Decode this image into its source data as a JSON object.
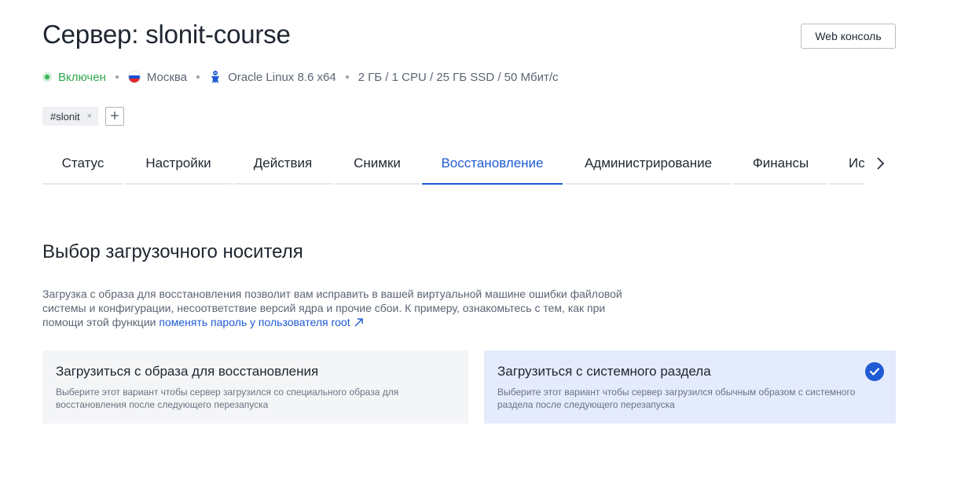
{
  "header": {
    "title": "Сервер: slonit-course",
    "web_console_label": "Web консоль"
  },
  "meta": {
    "status": "Включен",
    "location": "Москва",
    "os": "Oracle Linux 8.6 x64",
    "specs": "2 ГБ / 1 CPU / 25 ГБ SSD / 50 Мбит/с",
    "status_color": "#2fa84f"
  },
  "tags": [
    {
      "label": "#slonit",
      "remove_symbol": "×"
    }
  ],
  "tag_add_symbol": "+",
  "tabs": [
    {
      "label": "Статус",
      "active": false
    },
    {
      "label": "Настройки",
      "active": false
    },
    {
      "label": "Действия",
      "active": false
    },
    {
      "label": "Снимки",
      "active": false
    },
    {
      "label": "Восстановление",
      "active": true
    },
    {
      "label": "Администрирование",
      "active": false
    },
    {
      "label": "Финансы",
      "active": false
    },
    {
      "label": "История",
      "active": false
    }
  ],
  "section": {
    "title": "Выбор загрузочного носителя",
    "description": "Загрузка с образа для восстановления позволит вам исправить в вашей виртуальной машине ошибки файловой системы и конфигурации, несоответствие версий ядра и прочие сбои. К примеру, ознакомьтесь с тем, как при помощи этой функции",
    "link_text": "поменять пароль у пользователя root"
  },
  "options": [
    {
      "title": "Загрузиться с образа для восстановления",
      "text": "Выберите этот вариант чтобы сервер загрузился со специального образа для восстановления после следующего перезапуска",
      "selected": false
    },
    {
      "title": "Загрузиться с системного раздела",
      "text": "Выберите этот вариант чтобы сервер загрузился обычным образом с системного раздела после следующего перезапуска",
      "selected": true
    }
  ],
  "colors": {
    "accent": "#1f5bd4",
    "selected_card_bg": "#e4ebfc",
    "card_bg": "#f4f5f7"
  },
  "icons": {
    "status": "status-dot-icon",
    "location": "russia-flag-icon",
    "os": "oracle-linux-icon",
    "tabs_next": "chevron-right-icon",
    "link": "external-link-icon",
    "selected": "check-circle-icon"
  }
}
